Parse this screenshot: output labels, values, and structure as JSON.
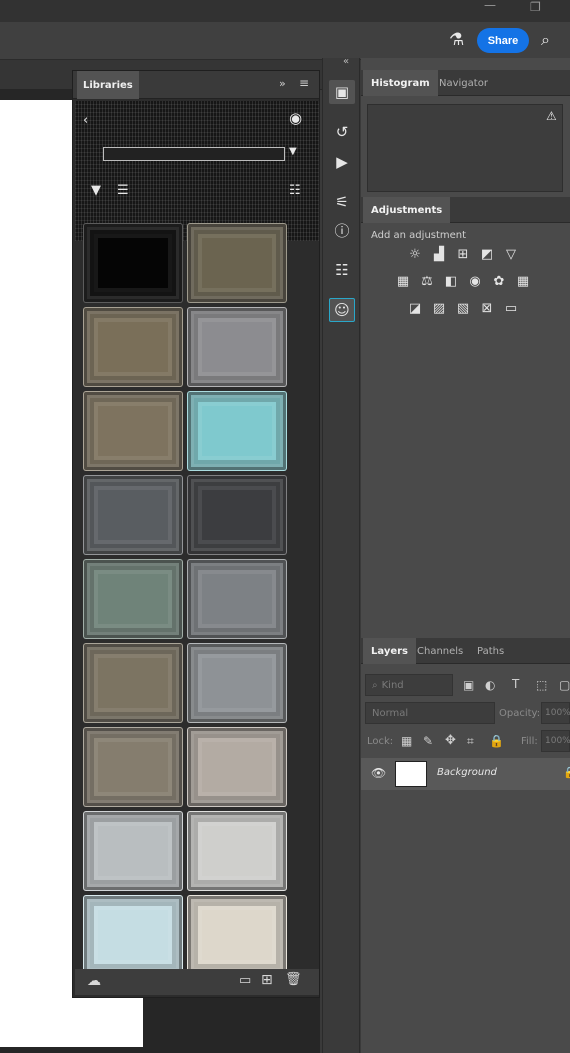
{
  "app": {
    "share_label": "Share"
  },
  "libraries": {
    "tab_label": "Libraries",
    "swatches": [
      "#050505",
      "#6b6450",
      "#7a6f59",
      "#8c8c90",
      "#7e735f",
      "#7fc9ce",
      "#595d61",
      "#3c3d40",
      "#6f8379",
      "#7d8185",
      "#7c7462",
      "#8e9296",
      "#857d6e",
      "#b3aba3",
      "#b9bec0",
      "#cfcfcc",
      "#c5dde3",
      "#ddd7cb"
    ]
  },
  "right_panels": {
    "tabs_top": [
      "Histogram",
      "Navigator"
    ],
    "adjustments_tab": "Adjustments",
    "add_adjustment": "Add an adjustment",
    "layers_tabs": [
      "Layers",
      "Channels",
      "Paths"
    ],
    "kind_placeholder": "Kind",
    "blend_mode": "Normal",
    "opacity_label": "Opacity:",
    "opacity_value": "100%",
    "lock_label": "Lock:",
    "fill_label": "Fill:",
    "fill_value": "100%",
    "layer_name": "Background"
  },
  "icons": {
    "titlebar": [
      "minimize-icon",
      "restore-icon"
    ],
    "menubar": [
      "beaker-icon",
      "search-icon"
    ],
    "dock": [
      "libraries-icon",
      "history-icon",
      "actions-play-icon",
      "properties-icon",
      "info-icon",
      "layer-comps-icon",
      "person-icon"
    ]
  }
}
